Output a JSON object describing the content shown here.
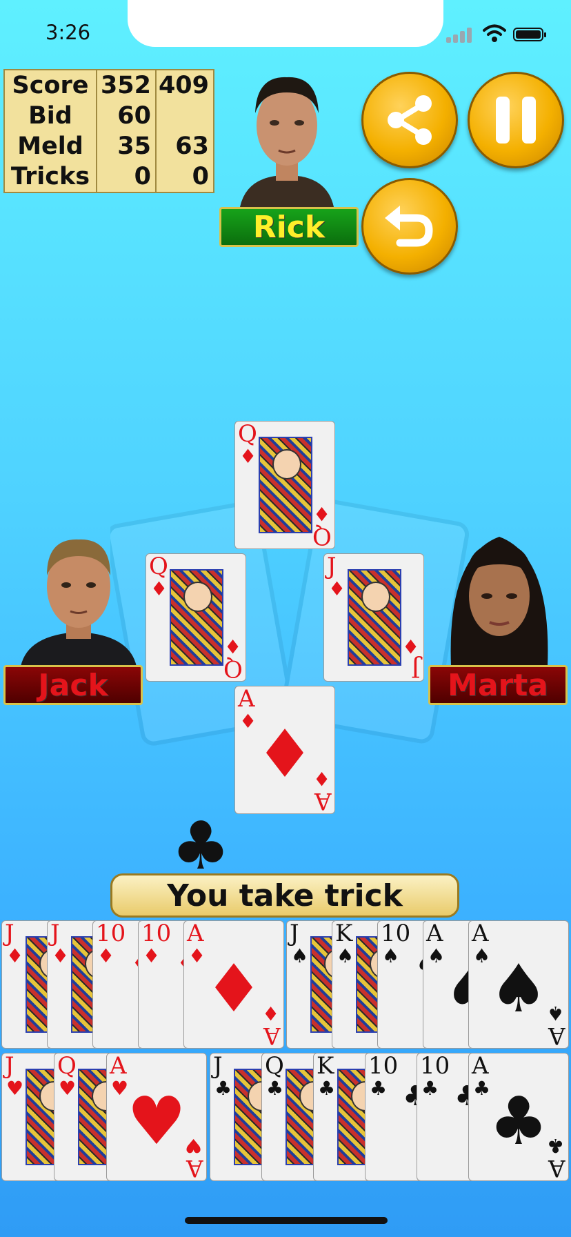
{
  "status_bar": {
    "time": "3:26"
  },
  "scoreboard": {
    "rows": [
      {
        "label": "Score",
        "team1": "352",
        "team2": "409"
      },
      {
        "label": "Bid",
        "team1": "60",
        "team2": ""
      },
      {
        "label": "Meld",
        "team1": "35",
        "team2": "63"
      },
      {
        "label": "Tricks",
        "team1": "0",
        "team2": "0"
      }
    ]
  },
  "players": {
    "north": "Rick",
    "west": "Jack",
    "east": "Marta"
  },
  "buttons": {
    "share": "share-icon",
    "pause": "pause-icon",
    "undo": "undo-icon"
  },
  "trick": {
    "north": {
      "rank": "Q",
      "suit": "♦"
    },
    "west": {
      "rank": "Q",
      "suit": "♦"
    },
    "east": {
      "rank": "J",
      "suit": "♦"
    },
    "south": {
      "rank": "A",
      "suit": "♦"
    }
  },
  "trump_suit": "♣",
  "message": "You take trick",
  "hand": {
    "row1": [
      {
        "rank": "J",
        "suit": "♦"
      },
      {
        "rank": "J",
        "suit": "♦"
      },
      {
        "rank": "10",
        "suit": "♦"
      },
      {
        "rank": "10",
        "suit": "♦"
      },
      {
        "rank": "A",
        "suit": "♦"
      },
      {
        "rank": "J",
        "suit": "♠"
      },
      {
        "rank": "K",
        "suit": "♠"
      },
      {
        "rank": "10",
        "suit": "♠"
      },
      {
        "rank": "A",
        "suit": "♠"
      },
      {
        "rank": "A",
        "suit": "♠"
      }
    ],
    "row2": [
      {
        "rank": "J",
        "suit": "♥"
      },
      {
        "rank": "Q",
        "suit": "♥"
      },
      {
        "rank": "A",
        "suit": "♥"
      },
      {
        "rank": "J",
        "suit": "♣"
      },
      {
        "rank": "Q",
        "suit": "♣"
      },
      {
        "rank": "K",
        "suit": "♣"
      },
      {
        "rank": "10",
        "suit": "♣"
      },
      {
        "rank": "10",
        "suit": "♣"
      },
      {
        "rank": "A",
        "suit": "♣"
      }
    ]
  },
  "colors": {
    "red_suit": "#e4141b",
    "black_suit": "#111111",
    "plate_gold_text": "#ffef2a"
  }
}
